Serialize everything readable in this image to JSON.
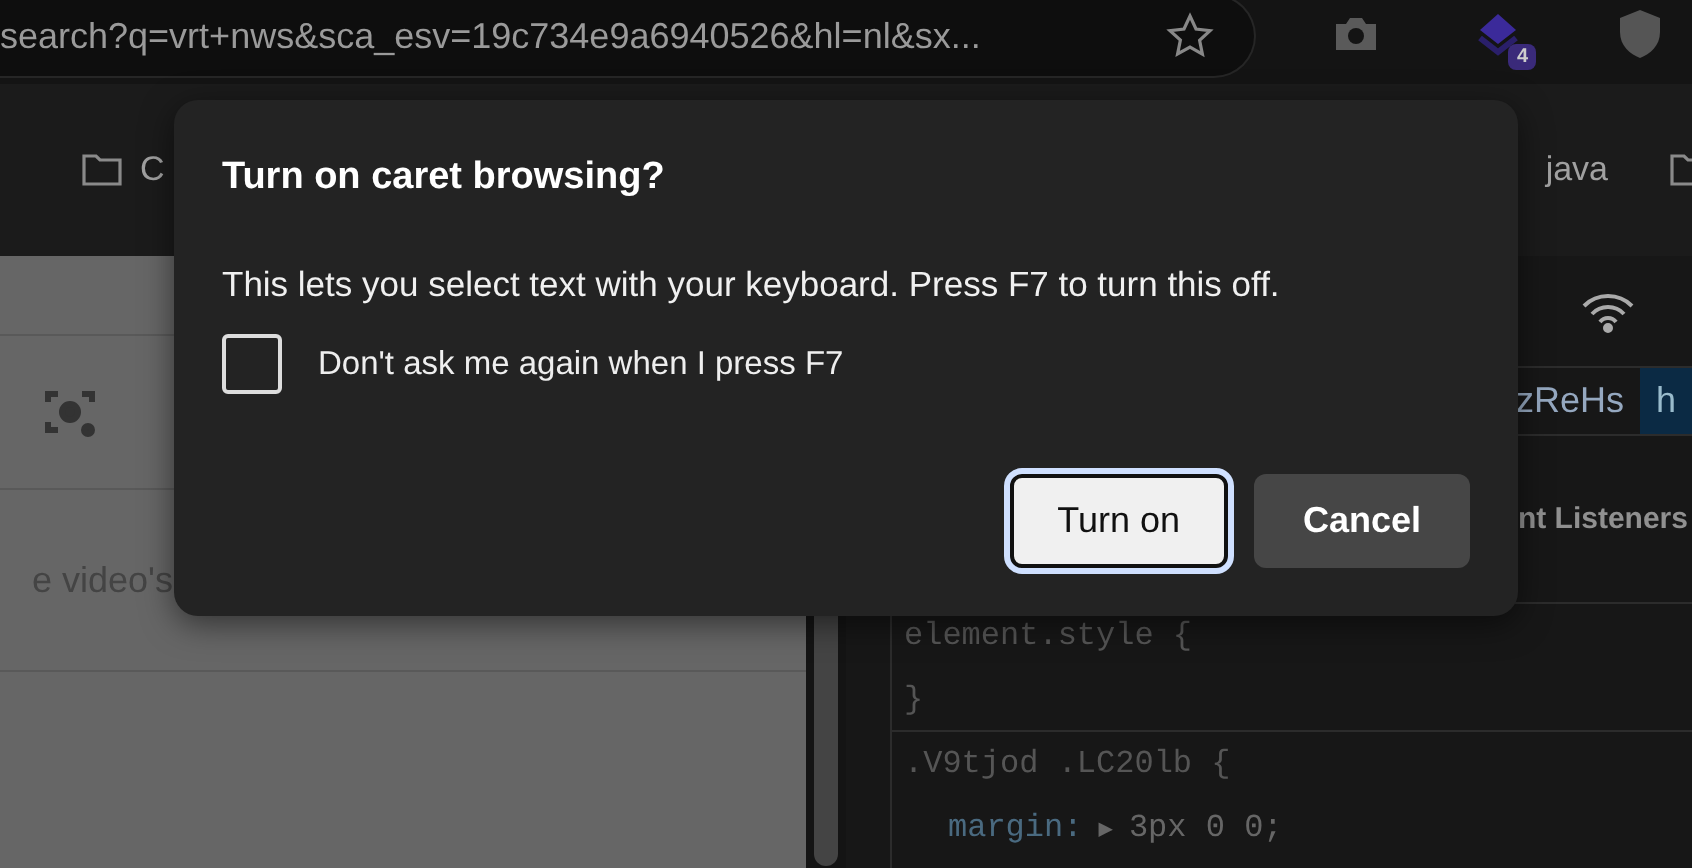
{
  "address_bar": {
    "url": "search?q=vrt+nws&sca_esv=19c734e9a6940526&hl=nl&sx..."
  },
  "toolbar": {
    "extension_badge": "4"
  },
  "bookmarks": [
    {
      "label": "C"
    },
    {
      "label": "java"
    }
  ],
  "page": {
    "tab_label": "e video's"
  },
  "devtools": {
    "breadcrumbs": [
      {
        "label": "zReHs",
        "selected": false
      },
      {
        "label": "h",
        "selected": true
      }
    ],
    "panel_tab": "nt Listeners",
    "code_lines": [
      {
        "kind": "selector",
        "text": "element.style {"
      },
      {
        "kind": "brace",
        "text": "}"
      },
      {
        "kind": "selector",
        "text": ".V9tjod .LC20lb {"
      },
      {
        "kind": "property",
        "name": "margin:",
        "expander": "▶",
        "value": "3px 0 0;"
      }
    ]
  },
  "dialog": {
    "title": "Turn on caret browsing?",
    "message": "This lets you select text with your keyboard. Press F7 to turn this off.",
    "checkbox": {
      "label": "Don't ask me again when I press F7",
      "checked": false
    },
    "buttons": [
      {
        "label": "Turn on",
        "focused": true
      },
      {
        "label": "Cancel",
        "focused": false
      }
    ]
  }
}
